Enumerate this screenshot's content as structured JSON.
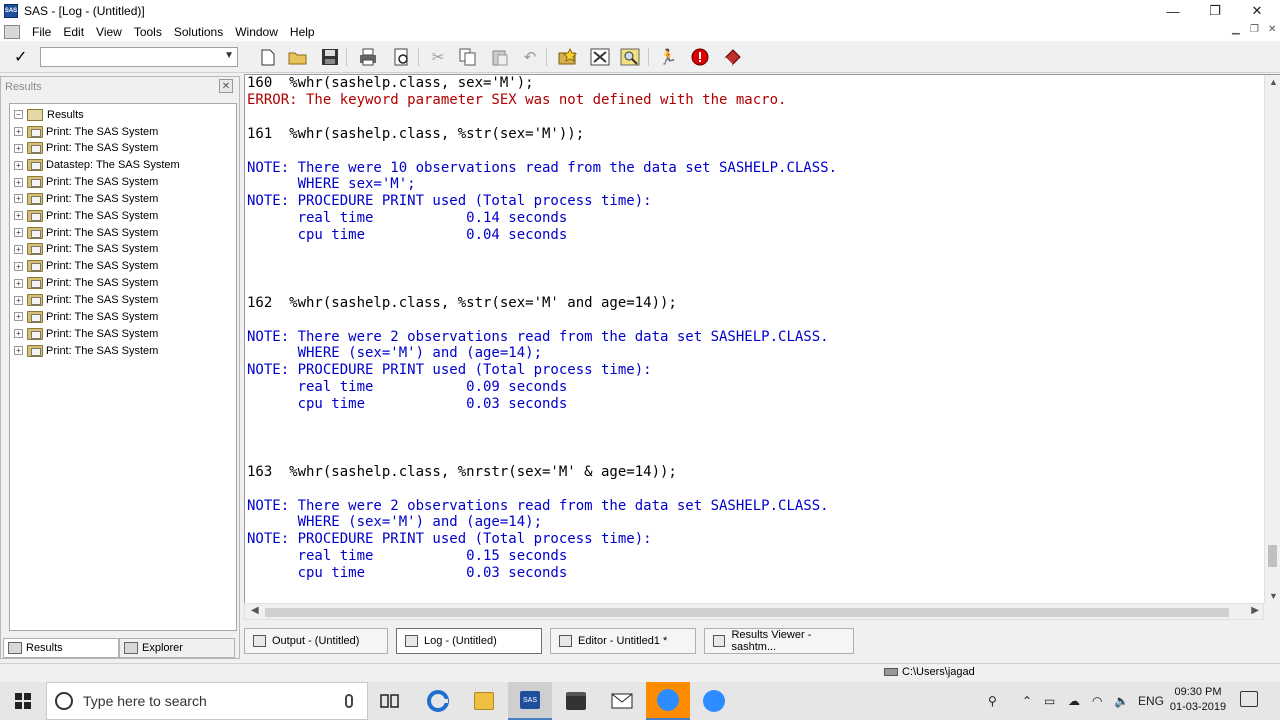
{
  "window": {
    "title": "SAS - [Log - (Untitled)]",
    "app_icon_text": "SAS",
    "minimize": "—",
    "restore": "❐",
    "close": "✕"
  },
  "menu": {
    "items": [
      "File",
      "Edit",
      "View",
      "Tools",
      "Solutions",
      "Window",
      "Help"
    ]
  },
  "toolbar": {
    "command_value": "",
    "check_symbol": "✓"
  },
  "results": {
    "header": "Results",
    "close_symbol": "✕",
    "root_label": "Results",
    "items": [
      "Print:  The SAS System",
      "Print:  The SAS System",
      "Datastep:  The SAS System",
      "Print:  The SAS System",
      "Print:  The SAS System",
      "Print:  The SAS System",
      "Print:  The SAS System",
      "Print:  The SAS System",
      "Print:  The SAS System",
      "Print:  The SAS System",
      "Print:  The SAS System",
      "Print:  The SAS System",
      "Print:  The SAS System",
      "Print:  The SAS System"
    ],
    "tab_results": "Results",
    "tab_explorer": "Explorer"
  },
  "log": {
    "colors": {
      "code": "#000000",
      "error": "#b00000",
      "note": "#0000cc"
    },
    "lines": [
      {
        "text": "160  %whr(sashelp.class, sex='M');",
        "kind": "code"
      },
      {
        "text": "ERROR: The keyword parameter SEX was not defined with the macro.",
        "kind": "error"
      },
      {
        "text": "",
        "kind": "code"
      },
      {
        "text": "161  %whr(sashelp.class, %str(sex='M'));",
        "kind": "code"
      },
      {
        "text": "",
        "kind": "code"
      },
      {
        "text": "NOTE: There were 10 observations read from the data set SASHELP.CLASS.",
        "kind": "note"
      },
      {
        "text": "      WHERE sex='M';",
        "kind": "note"
      },
      {
        "text": "NOTE: PROCEDURE PRINT used (Total process time):",
        "kind": "note"
      },
      {
        "text": "      real time           0.14 seconds",
        "kind": "note"
      },
      {
        "text": "      cpu time            0.04 seconds",
        "kind": "note"
      },
      {
        "text": "",
        "kind": "code"
      },
      {
        "text": "",
        "kind": "code"
      },
      {
        "text": "",
        "kind": "code"
      },
      {
        "text": "162  %whr(sashelp.class, %str(sex='M' and age=14));",
        "kind": "code"
      },
      {
        "text": "",
        "kind": "code"
      },
      {
        "text": "NOTE: There were 2 observations read from the data set SASHELP.CLASS.",
        "kind": "note"
      },
      {
        "text": "      WHERE (sex='M') and (age=14);",
        "kind": "note"
      },
      {
        "text": "NOTE: PROCEDURE PRINT used (Total process time):",
        "kind": "note"
      },
      {
        "text": "      real time           0.09 seconds",
        "kind": "note"
      },
      {
        "text": "      cpu time            0.03 seconds",
        "kind": "note"
      },
      {
        "text": "",
        "kind": "code"
      },
      {
        "text": "",
        "kind": "code"
      },
      {
        "text": "",
        "kind": "code"
      },
      {
        "text": "163  %whr(sashelp.class, %nrstr(sex='M' & age=14));",
        "kind": "code"
      },
      {
        "text": "",
        "kind": "code"
      },
      {
        "text": "NOTE: There were 2 observations read from the data set SASHELP.CLASS.",
        "kind": "note"
      },
      {
        "text": "      WHERE (sex='M') and (age=14);",
        "kind": "note"
      },
      {
        "text": "NOTE: PROCEDURE PRINT used (Total process time):",
        "kind": "note"
      },
      {
        "text": "      real time           0.15 seconds",
        "kind": "note"
      },
      {
        "text": "      cpu time            0.03 seconds",
        "kind": "note"
      }
    ]
  },
  "window_tabs": [
    {
      "label": "Output - (Untitled)",
      "active": false
    },
    {
      "label": "Log - (Untitled)",
      "active": true
    },
    {
      "label": "Editor - Untitled1 *",
      "active": false
    },
    {
      "label": "Results Viewer - sashtm...",
      "active": false
    }
  ],
  "status": {
    "path": "C:\\Users\\jagad"
  },
  "taskbar": {
    "search_placeholder": "Type here to search",
    "language": "ENG",
    "time": "09:30 PM",
    "date": "01-03-2019"
  }
}
